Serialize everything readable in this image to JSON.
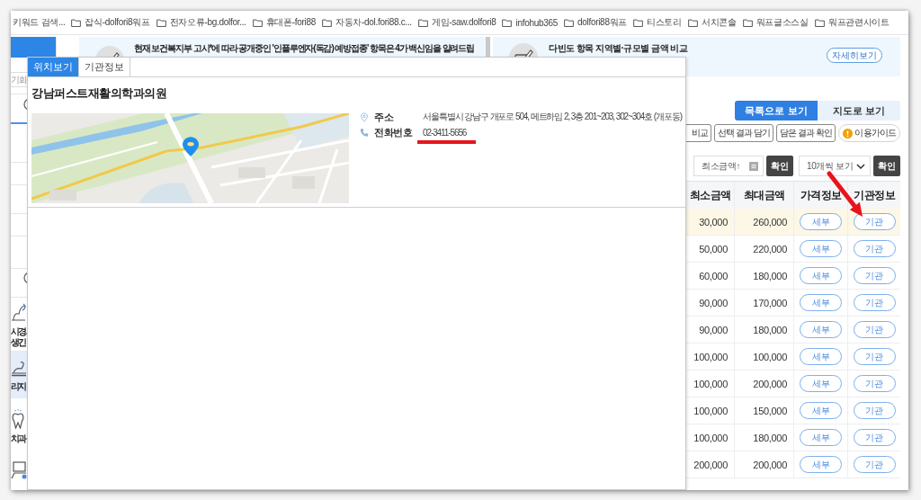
{
  "bookmarks_bar": {
    "items": [
      {
        "label": "키워드 검색...",
        "kind": "page"
      },
      {
        "label": "잡식-dolfori8워프",
        "kind": "folder"
      },
      {
        "label": "전자오류-bg.dolfor...",
        "kind": "folder"
      },
      {
        "label": "휴대폰-fori88",
        "kind": "folder"
      },
      {
        "label": "자동차-dol.fori88.c...",
        "kind": "folder"
      },
      {
        "label": "게임-saw.dolfori8",
        "kind": "folder"
      },
      {
        "label": "infohub365",
        "kind": "folder"
      },
      {
        "label": "dolfori88워프",
        "kind": "folder"
      },
      {
        "label": "티스토리",
        "kind": "folder"
      },
      {
        "label": "서치콘솔",
        "kind": "folder"
      },
      {
        "label": "워프글소스실",
        "kind": "folder"
      },
      {
        "label": "워프관련사이트",
        "kind": "folder"
      }
    ]
  },
  "sidebar": {
    "field_text": "기화",
    "cards": [
      {
        "kind": "tube",
        "lines": [
          "시경,",
          "생긴"
        ],
        "selected": false
      },
      {
        "kind": "chair",
        "lines": [
          "리지"
        ],
        "selected": true
      },
      {
        "kind": "tooth",
        "lines": [
          "치과"
        ],
        "selected": false
      },
      {
        "kind": "monitor",
        "selected": false
      }
    ]
  },
  "notices": [
    {
      "text": "현재 보건복지부 고시*에 따라 공개중인 '인플루엔자(독감) 예방접종' 항목은 4가 백신임을 알려드립"
    },
    {
      "text": "다빈도 항목 지역별·규모별 금액 비교",
      "button": "자세히보기"
    }
  ],
  "results": {
    "view_tabs": [
      {
        "label": "목록으로 보기",
        "selected": true
      },
      {
        "label": "지도로 보기",
        "selected": false
      }
    ],
    "actions": [
      {
        "label": "비교",
        "kind": "plain"
      },
      {
        "label": "선택 결과 담기",
        "kind": "plain"
      },
      {
        "label": "담은 결과 확인",
        "kind": "plain"
      },
      {
        "label": "이용가이드",
        "kind": "guide"
      }
    ],
    "sort": {
      "order_select": "최소금액↑",
      "order_button": "확인",
      "size_select": "10개씩 보기",
      "size_button": "확인"
    },
    "table": {
      "columns": [
        "최소금액",
        "최대금액",
        "가격정보",
        "기관정보"
      ],
      "rows": [
        {
          "min": "30,000",
          "max": "260,000",
          "detail": "세부",
          "org": "기관",
          "selected": true,
          "arrow": true
        },
        {
          "min": "50,000",
          "max": "220,000",
          "detail": "세부",
          "org": "기관",
          "selected": false,
          "arrow": false
        },
        {
          "min": "60,000",
          "max": "180,000",
          "detail": "세부",
          "org": "기관",
          "selected": false,
          "arrow": false
        },
        {
          "min": "90,000",
          "max": "170,000",
          "detail": "세부",
          "org": "기관",
          "selected": false,
          "arrow": false
        },
        {
          "min": "90,000",
          "max": "180,000",
          "detail": "세부",
          "org": "기관",
          "selected": false,
          "arrow": false
        },
        {
          "min": "100,000",
          "max": "100,000",
          "detail": "세부",
          "org": "기관",
          "selected": false,
          "arrow": false
        },
        {
          "min": "100,000",
          "max": "200,000",
          "detail": "세부",
          "org": "기관",
          "selected": false,
          "arrow": false
        },
        {
          "min": "100,000",
          "max": "150,000",
          "detail": "세부",
          "org": "기관",
          "selected": false,
          "arrow": false
        },
        {
          "min": "100,000",
          "max": "180,000",
          "detail": "세부",
          "org": "기관",
          "selected": false,
          "arrow": false
        },
        {
          "min": "200,000",
          "max": "200,000",
          "detail": "세부",
          "org": "기관",
          "selected": false,
          "arrow": false
        }
      ]
    }
  },
  "popup": {
    "tabs": [
      {
        "label": "위치보기",
        "selected": true
      },
      {
        "label": "기관정보",
        "selected": false
      }
    ],
    "title": "강남퍼스트재활의학과의원",
    "fields": [
      {
        "kind": "address",
        "label": "주소",
        "value": "서울특별시 강남구 개포로 504, 메트하임 2, 3층 201~203, 302~304호 (개포동)",
        "underlined": false
      },
      {
        "kind": "phone",
        "label": "전화번호",
        "value": "02-3411-5656",
        "underlined": true
      }
    ]
  }
}
